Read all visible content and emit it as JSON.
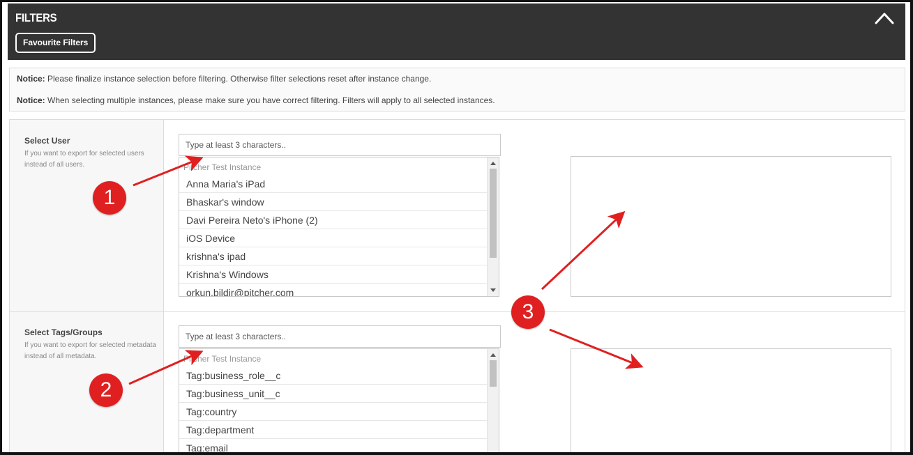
{
  "header": {
    "title": "FILTERS",
    "favourite_button": "Favourite Filters",
    "collapse_icon": "chevron-up-icon"
  },
  "notices": [
    {
      "label": "Notice:",
      "text": " Please finalize instance selection before filtering. Otherwise filter selections reset after instance change."
    },
    {
      "label": "Notice:",
      "text": " When selecting multiple instances, please make sure you have correct filtering. Filters will apply to all selected instances."
    }
  ],
  "user_filter": {
    "title": "Select User",
    "help": "If you want to export for selected users instead of all users.",
    "placeholder": "Type at least 3 characters..",
    "group": "Pitcher Test Instance",
    "items": [
      "Anna Maria's iPad",
      "Bhaskar's window",
      "Davi Pereira Neto's iPhone (2)",
      "iOS Device",
      "krishna's ipad",
      "Krishna's Windows",
      "orkun.bildir@pitcher.com"
    ]
  },
  "tags_filter": {
    "title": "Select Tags/Groups",
    "help": "If you want to export for selected metadata instead of all metadata.",
    "placeholder": "Type at least 3 characters..",
    "group": "Pitcher Test Instance",
    "items": [
      "Tag:business_role__c",
      "Tag:business_unit__c",
      "Tag:country",
      "Tag:department",
      "Tag:email"
    ]
  },
  "annotations": {
    "marker_1": "1",
    "marker_2": "2",
    "marker_3": "3",
    "color": "#e02020"
  },
  "colors": {
    "header_bg": "#333333",
    "annotation_red": "#e02020"
  }
}
